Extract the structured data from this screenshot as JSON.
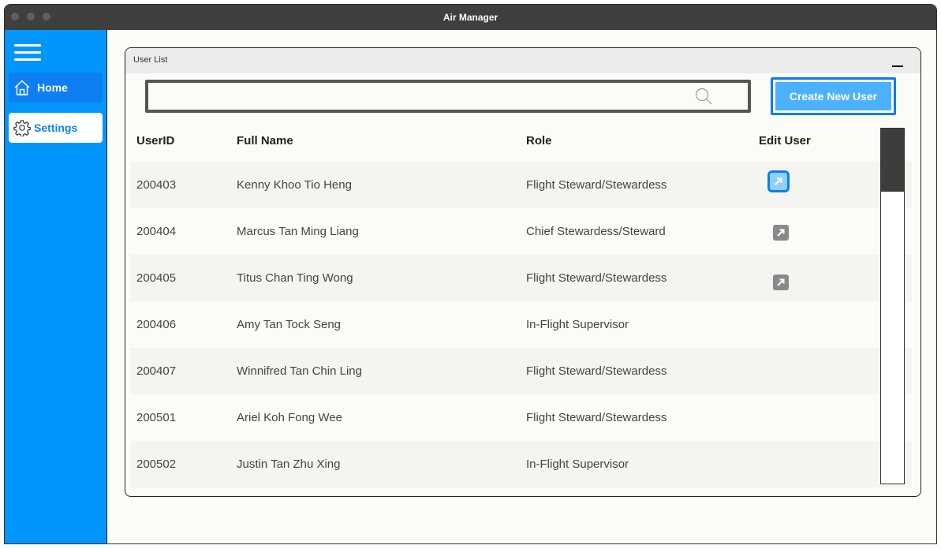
{
  "window": {
    "title": "Air Manager"
  },
  "sidebar": {
    "menu_icon": "hamburger-icon",
    "items": [
      {
        "label": "Home",
        "icon": "home-icon",
        "active": true
      },
      {
        "label": "Settings",
        "icon": "gear-icon",
        "active": false
      }
    ]
  },
  "panel": {
    "title": "User List",
    "search": {
      "value": "",
      "placeholder": "",
      "icon": "search-icon"
    },
    "create_button": "Create New User"
  },
  "table": {
    "headers": [
      "UserID",
      "Full Name",
      "Role",
      "Edit User"
    ],
    "rows": [
      {
        "id": "200403",
        "name": "Kenny Khoo Tio Heng",
        "role": "Flight Steward/Stewardess",
        "editable": true
      },
      {
        "id": "200404",
        "name": "Marcus Tan Ming Liang",
        "role": "Chief Stewardess/Steward",
        "editable": true
      },
      {
        "id": "200405",
        "name": "Titus Chan Ting Wong",
        "role": "Flight Steward/Stewardess",
        "editable": true
      },
      {
        "id": "200406",
        "name": "Amy Tan Tock Seng",
        "role": "In-Flight Supervisor",
        "editable": false
      },
      {
        "id": "200407",
        "name": "Winnifred Tan Chin Ling",
        "role": "Flight Steward/Stewardess",
        "editable": false
      },
      {
        "id": "200501",
        "name": "Ariel Koh Fong Wee",
        "role": "Flight Steward/Stewardess",
        "editable": false
      },
      {
        "id": "200502",
        "name": "Justin Tan Zhu Xing",
        "role": "In-Flight Supervisor",
        "editable": false
      }
    ]
  },
  "colors": {
    "sidebar": "#0096fb",
    "accent": "#0a7cf0",
    "button_fill": "#4cb2ff",
    "titlebar": "#3f3f3f"
  }
}
